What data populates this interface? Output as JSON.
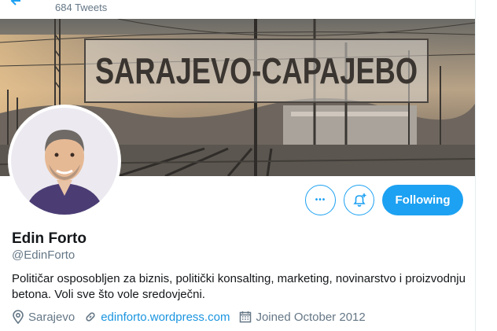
{
  "header": {
    "tweet_count": "684 Tweets"
  },
  "banner": {
    "sign_text": "SARAJEVO-CAPAJEBO"
  },
  "actions": {
    "more_glyph": "•••",
    "follow_label": "Following"
  },
  "profile": {
    "name": "Edin Forto",
    "handle": "@EdinForto",
    "bio": "Političar osposobljen za biznis, politički konsalting, marketing, novinarstvo i proizvodnju betona. Voli sve što vole sredovječni.",
    "location": "Sarajevo",
    "website": "edinforto.wordpress.com",
    "joined": "Joined October 2012"
  },
  "icons": [
    "back-arrow-icon",
    "more-icon",
    "notification-bell-icon",
    "location-icon",
    "link-icon",
    "calendar-icon"
  ],
  "colors": {
    "accent": "#1da1f2",
    "link": "#1b95e0",
    "secondary_text": "#657786"
  }
}
